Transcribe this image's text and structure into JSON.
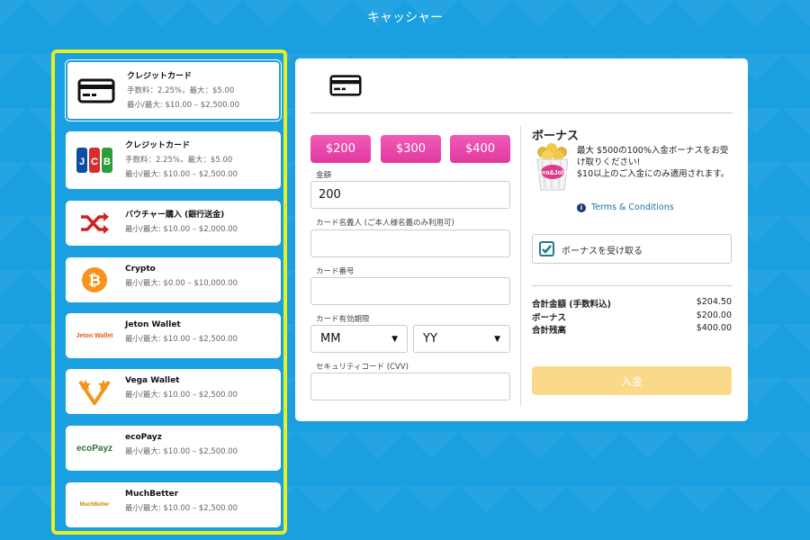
{
  "header": {
    "title": "キャッシャー"
  },
  "methods": [
    {
      "name": "クレジットカード",
      "fee": "手数料：2.25%，最大：$5.00",
      "limit": "最小/最大: $10.00 – $2,500.00",
      "icon": "credit-card-icon"
    },
    {
      "name": "クレジットカード",
      "fee": "手数料：2.25%，最大：$5.00",
      "limit": "最小/最大: $10.00 – $2,500.00",
      "icon": "jcb-logo"
    },
    {
      "name": "バウチャー購入 (銀行送金)",
      "limit": "最小/最大: $10.00 – $2,000.00",
      "icon": "shuffle-icon"
    },
    {
      "name": "Crypto",
      "limit": "最小/最大: $0.00 – $10,000.00",
      "icon": "bitcoin-icon"
    },
    {
      "name": "Jeton Wallet",
      "limit": "最小/最大: $10.00 – $2,500.00",
      "icon": "jeton-wallet-logo",
      "logo_text": "Jeton Wallet"
    },
    {
      "name": "Vega Wallet",
      "limit": "最小/最大: $10.00 – $2,500.00",
      "icon": "vega-wallet-logo"
    },
    {
      "name": "ecoPayz",
      "limit": "最小/最大: $10.00 – $2,500.00",
      "icon": "ecopayz-logo",
      "logo_text": "ecoPayz"
    },
    {
      "name": "MuchBetter",
      "limit": "最小/最大: $10.00 – $2,500.00",
      "icon": "muchbetter-logo",
      "logo_text": "MuchBetter"
    }
  ],
  "form": {
    "amount_buttons": [
      "$200",
      "$300",
      "$400"
    ],
    "amount_label": "金額",
    "amount_value": "200",
    "holder_label": "カード名義人 (ご本人様名義のみ利用可)",
    "holder_value": "",
    "number_label": "カード番号",
    "number_value": "",
    "expiry_label": "カード有効期限",
    "month_value": "MM",
    "year_value": "YY",
    "cvv_label": "セキュリティコード (CVV)",
    "cvv_value": ""
  },
  "bonus": {
    "title": "ボーナス",
    "text_line1": "最大 $500の100%入金ボーナスをお受け取りください!",
    "text_line2": "$10以上のご入金にのみ適用されます。",
    "image_text": "Vera&John",
    "terms_link": "Terms & Conditions",
    "checkbox_label": "ボーナスを受け取る",
    "checked": true
  },
  "summary": [
    {
      "label": "合計金額 (手数料込)",
      "value": "$204.50"
    },
    {
      "label": "ボーナス",
      "value": "$200.00"
    },
    {
      "label": "合計残高",
      "value": "$400.00"
    }
  ],
  "deposit_button": "入金",
  "colors": {
    "background": "#1a9fe0",
    "highlight_border": "#e6f21f",
    "amount_button": "#e0389f",
    "deposit_button": "#fbd98a"
  }
}
